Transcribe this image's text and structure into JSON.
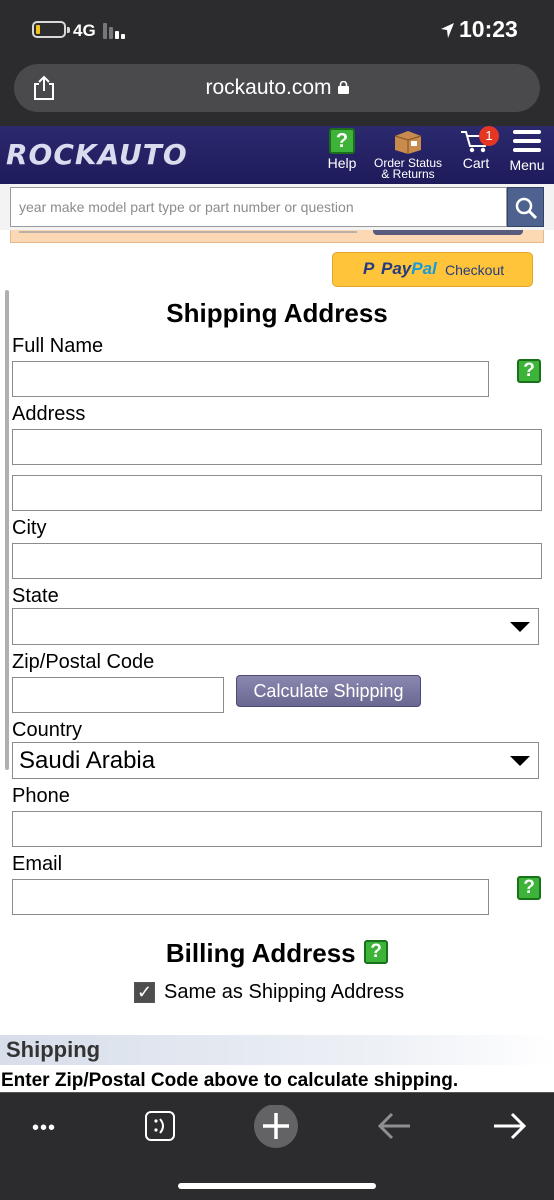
{
  "status_bar": {
    "network": "4G",
    "time": "10:23"
  },
  "browser": {
    "url": "rockauto.com"
  },
  "header": {
    "logo": "ROCKAUTO",
    "help_label": "Help",
    "order_status_line1": "Order Status",
    "order_status_line2": "& Returns",
    "cart_label": "Cart",
    "cart_count": "1",
    "menu_label": "Menu",
    "help_icon_text": "?"
  },
  "search": {
    "placeholder": "year make model part type or part number or question"
  },
  "paypal": {
    "p": "P",
    "pay": "Pay",
    "pal": "Pal",
    "checkout": "Checkout"
  },
  "shipping_address": {
    "title": "Shipping Address",
    "full_name_label": "Full Name",
    "address_label": "Address",
    "city_label": "City",
    "state_label": "State",
    "state_value": "",
    "zip_label": "Zip/Postal Code",
    "calc_button": "Calculate Shipping",
    "country_label": "Country",
    "country_value": "Saudi Arabia",
    "phone_label": "Phone",
    "email_label": "Email",
    "help_text": "?"
  },
  "billing": {
    "title": "Billing Address",
    "help_text": "?",
    "same_as_shipping": "Same as Shipping Address",
    "check_mark": "✓"
  },
  "shipping": {
    "header": "Shipping",
    "note": "Enter Zip/Postal Code above to calculate shipping."
  },
  "toolbar": {
    "more": "•••"
  },
  "colors": {
    "header_bg": "#1d1b5a",
    "help_green": "#3db33a",
    "paypal_yellow": "#ffc43a",
    "cart_badge": "#e53624"
  }
}
